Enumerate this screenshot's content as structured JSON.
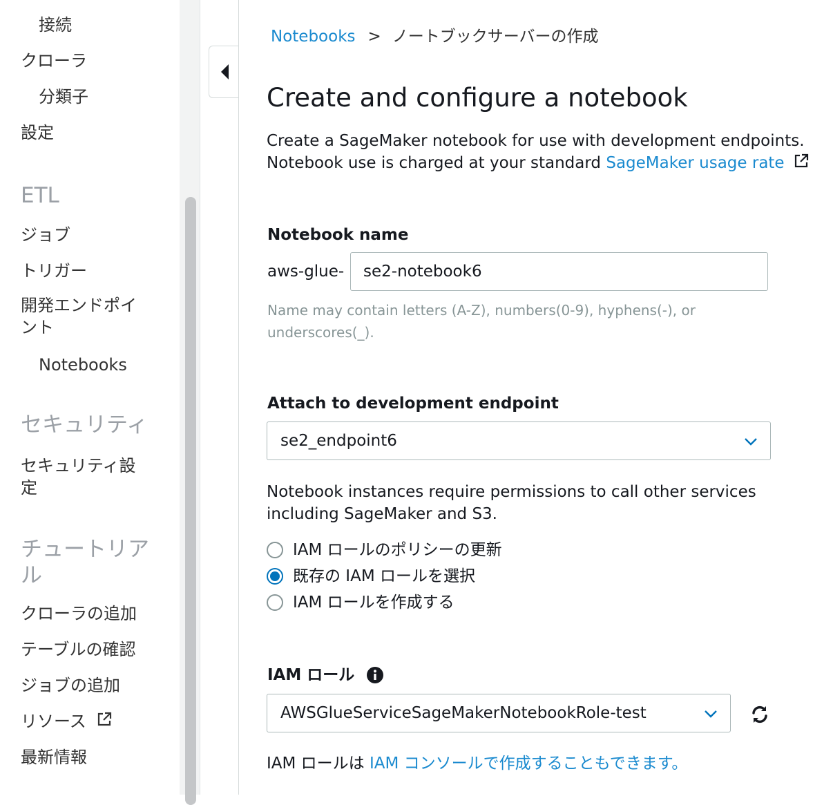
{
  "sidebar": {
    "items": [
      {
        "label": "接続"
      },
      {
        "label": "クローラ"
      },
      {
        "label": "分類子"
      },
      {
        "label": "設定"
      },
      {
        "label": "ETL"
      },
      {
        "label": "ジョブ"
      },
      {
        "label": "トリガー"
      },
      {
        "label": "開発エンドポイント"
      },
      {
        "label": "Notebooks"
      },
      {
        "label": "セキュリティ"
      },
      {
        "label": "セキュリティ設定"
      },
      {
        "label": "チュートリアル"
      },
      {
        "label": "クローラの追加"
      },
      {
        "label": "テーブルの確認"
      },
      {
        "label": "ジョブの追加"
      },
      {
        "label": "リソース"
      },
      {
        "label": "最新情報"
      }
    ]
  },
  "breadcrumb": {
    "parent": "Notebooks",
    "separator": ">",
    "current": "ノートブックサーバーの作成"
  },
  "page": {
    "title": "Create and configure a notebook",
    "description_line1": "Create a SageMaker notebook for use with development endpoints.",
    "description_line2": "Notebook use is charged at your standard ",
    "usage_link": "SageMaker usage rate"
  },
  "notebook_name": {
    "label": "Notebook name",
    "prefix": "aws-glue-",
    "value": "se2-notebook6",
    "hint": "Name may contain letters (A-Z), numbers(0-9), hyphens(-), or underscores(_)."
  },
  "endpoint": {
    "label": "Attach to development endpoint",
    "selected": "se2_endpoint6"
  },
  "permissions": {
    "text": "Notebook instances require permissions to call other services including SageMaker and S3.",
    "options": [
      {
        "label": "IAM ロールのポリシーの更新",
        "checked": false
      },
      {
        "label": "既存の IAM ロールを選択",
        "checked": true
      },
      {
        "label": "IAM ロールを作成する",
        "checked": false
      }
    ]
  },
  "iam_role": {
    "label": "IAM ロール",
    "selected": "AWSGlueServiceSageMakerNotebookRole-test",
    "footer_prefix": "IAM ロールは ",
    "footer_link": "IAM コンソールで作成することもできます。"
  },
  "colors": {
    "link": "#1a8acf",
    "radio_selected": "#0073bb",
    "section_heading": "#9ba0a6",
    "hint": "#879596"
  },
  "icons": [
    "external-link-icon",
    "collapse-arrow-icon",
    "chevron-down-icon",
    "info-icon",
    "refresh-icon"
  ]
}
